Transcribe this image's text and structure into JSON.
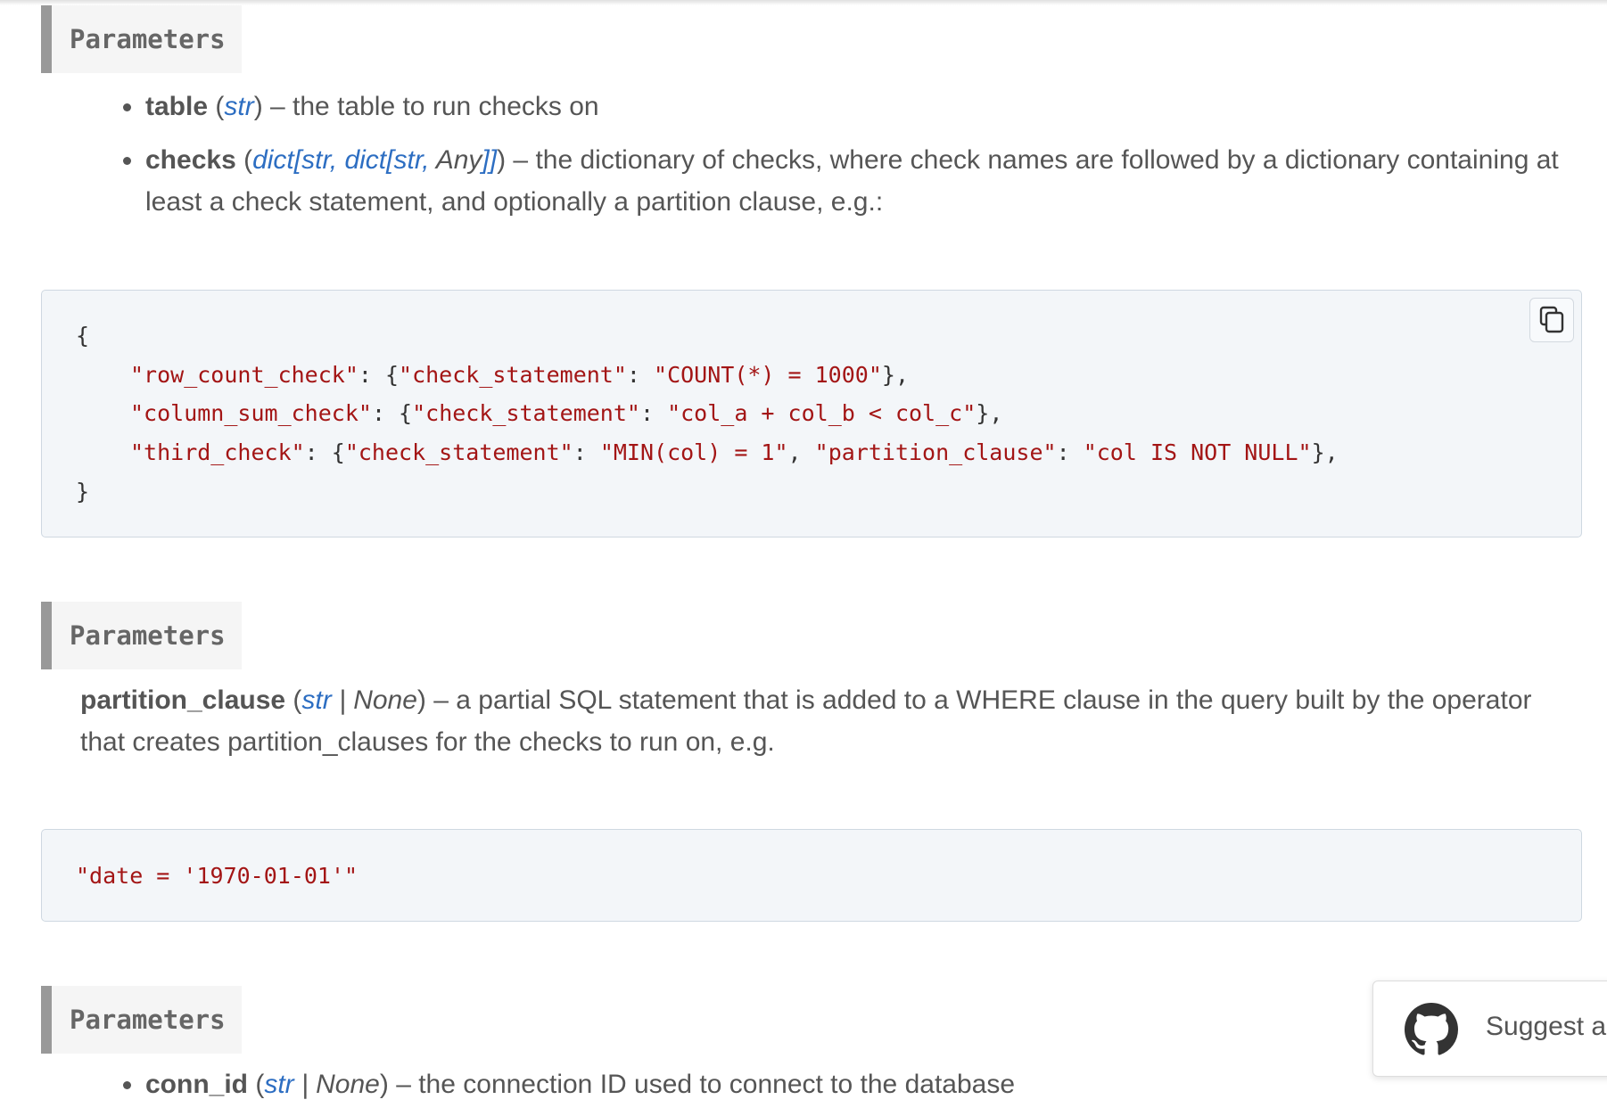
{
  "sections": [
    {
      "header": "Parameters",
      "params": [
        {
          "name": "table",
          "open": " (",
          "type": "str",
          "close": ")",
          "desc": " – the table to run checks on"
        },
        {
          "name": "checks",
          "open": " (",
          "type_parts": [
            "dict",
            "[",
            "str",
            ", ",
            "dict",
            "[",
            "str",
            ", ",
            "Any",
            "]]"
          ],
          "close": ")",
          "desc": " – the dictionary of checks, where check names are followed by a dictionary containing at least a check statement, and optionally a partition clause, e.g.:"
        }
      ]
    },
    {
      "header": "Parameters",
      "param": {
        "name": "partition_clause",
        "open": " (",
        "type": "str",
        "sep": " | ",
        "type2": "None",
        "close": ")",
        "desc": " – a partial SQL statement that is added to a WHERE clause in the query built by the operator that creates partition_clauses for the checks to run on, e.g."
      }
    },
    {
      "header": "Parameters",
      "param": {
        "name": "conn_id",
        "open": " (",
        "type": "str",
        "sep": " | ",
        "type2": "None",
        "close": ")",
        "desc": " – the connection ID used to connect to the database"
      }
    }
  ],
  "code_block_1": {
    "open_brace": "{",
    "close_brace": "}",
    "lines": [
      {
        "k": "\"row_count_check\"",
        "p1": ": {",
        "k2": "\"check_statement\"",
        "p2": ": ",
        "v": "\"COUNT(*) = 1000\"",
        "end": "},"
      },
      {
        "k": "\"column_sum_check\"",
        "p1": ": {",
        "k2": "\"check_statement\"",
        "p2": ": ",
        "v": "\"col_a + col_b < col_c\"",
        "end": "},"
      },
      {
        "k": "\"third_check\"",
        "p1": ": {",
        "k2": "\"check_statement\"",
        "p2": ": ",
        "v": "\"MIN(col) = 1\"",
        "p3": ", ",
        "k3": "\"partition_clause\"",
        "p4": ": ",
        "v2": "\"col IS NOT NULL\"",
        "end": "},"
      }
    ]
  },
  "code_block_2": {
    "line": "\"date = '1970-01-01'\""
  },
  "suggest": {
    "label": "Suggest a"
  },
  "colors": {
    "link": "#2d6ec2",
    "code_string": "#a31515",
    "header_bar": "#999999"
  },
  "icons": {
    "copy": "copy-icon",
    "github": "github-icon"
  }
}
